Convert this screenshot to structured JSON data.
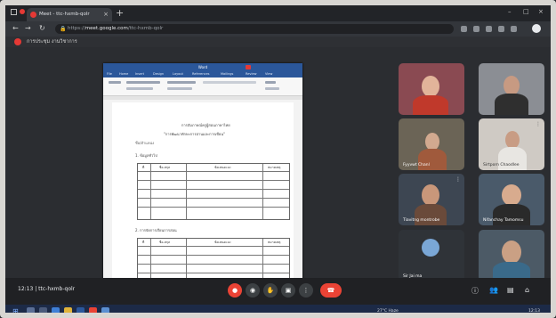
{
  "browser": {
    "tab_title": "Meet - ttc-hxmb-qolr",
    "new_tab": "+",
    "url_prefix": "https://",
    "url_host": "meet.google.com",
    "url_path": "/ttc-hxmb-qolr",
    "window_controls": [
      "–",
      "□",
      "×"
    ],
    "bookmark": "การประชุม งานวิชาการ"
  },
  "document": {
    "app_title": "Word",
    "ribbon_tabs": [
      "File",
      "Home",
      "Insert",
      "Design",
      "Layout",
      "References",
      "Mailings",
      "Review",
      "View"
    ],
    "heading": "การสัมภาษณ์ครูผู้สอนภาษาไทย",
    "subheading": "\"การพัฒนาทักษะการอ่านและการเขียน\"",
    "intro": "ชื่อ/ตำแหน่ง",
    "section1": "1. ข้อมูลทั่วไป",
    "section2": "2. การจัดการเรียนการสอน",
    "table1_headers": [
      "ที่",
      "ชื่อ-สกุล",
      "ข้อเสนอแนะ",
      "หมายเหตุ"
    ],
    "table2_headers": [
      "ที่",
      "ชื่อ-สกุล",
      "ข้อเสนอแนะ",
      "หมายเหตุ"
    ]
  },
  "participants": [
    {
      "name": "",
      "bg": "#8a4a52"
    },
    {
      "name": "",
      "bg": "#8b8e94"
    },
    {
      "name": "Fyyvwt Chanl",
      "bg": "#6b6456"
    },
    {
      "name": "Sirtporn Chaodlee",
      "bg": "#cfcac4"
    },
    {
      "name": "Tiavitng montrobe",
      "bg": "#3d4652"
    },
    {
      "name": "Nifanchay Tamomsu",
      "bg": "#4a5a6a"
    },
    {
      "name": "Sir Jai ma",
      "bg": "#2f3338"
    },
    {
      "name": "",
      "bg": "#4c5a66"
    }
  ],
  "meeting": {
    "time": "12:13",
    "code": "ttc-hxmb-qolr",
    "separator": "|"
  },
  "taskbar": {
    "weather": "27°C Haze",
    "clock": "12:13"
  },
  "colors": {
    "accent_red": "#ea4335",
    "meet_bg": "#202124",
    "word_blue": "#2b579a"
  }
}
